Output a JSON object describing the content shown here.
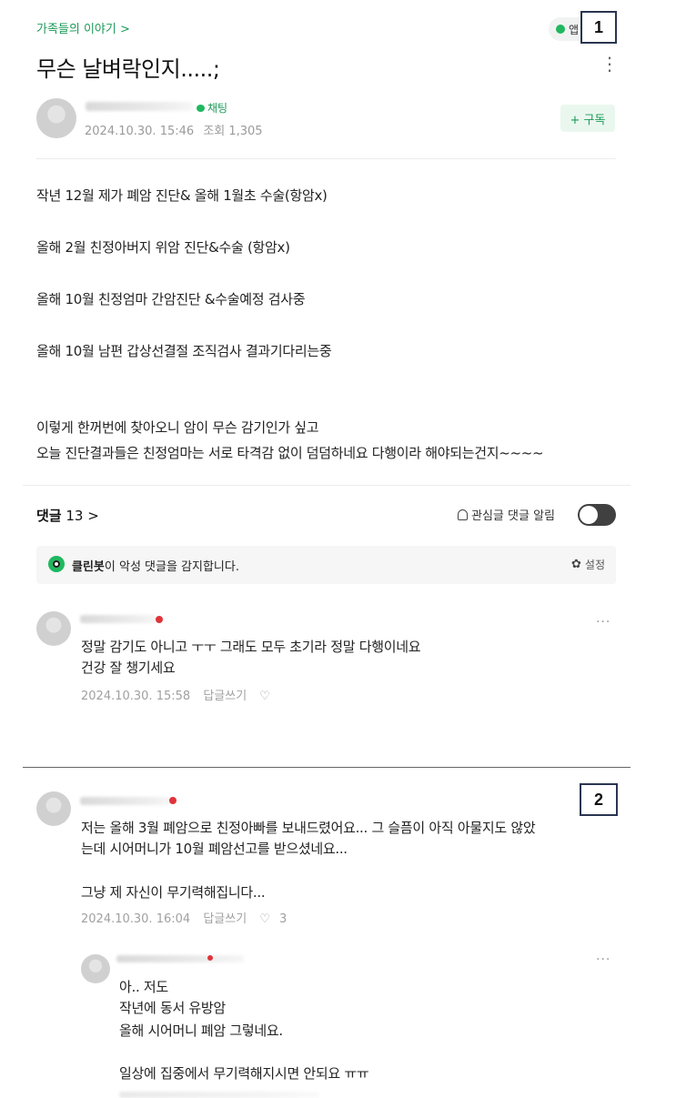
{
  "header": {
    "cafe_link": "가족들의 이야기 >",
    "app_badge": "앱",
    "marker_1": "1",
    "title": "무슨 날벼락인지.....;",
    "kebab": "⋮"
  },
  "author": {
    "chat_label": "채팅",
    "date": "2024.10.30. 15:46",
    "views": "조회 1,305",
    "subscribe": "+ 구독"
  },
  "post": {
    "lines": [
      "작년 12월 제가 폐암 진단& 올해 1월초 수술(항암x)",
      "올해 2월 친정아버지 위암 진단&수술 (항암x)",
      "올해 10월 친정엄마 간암진단 &수술예정 검사중",
      "올해 10월 남편 갑상선결절 조직검사 결과기다리는중",
      "이렇게 한꺼번에 찾아오니 암이 무슨 감기인가 싶고",
      "오늘 진단결과들은 친정엄마는 서로 타격감 없이 덤덤하네요 다행이라 해야되는건지~~~~"
    ]
  },
  "comments_bar": {
    "label": "댓글",
    "count": "13 >",
    "alarm": "관심글 댓글 알림"
  },
  "cleanbot": {
    "name": "클린봇",
    "text": "이 악성 댓글을 감지합니다.",
    "settings": "설정"
  },
  "comments": [
    {
      "lines": [
        "정말 감기도 아니고 ㅜㅜ 그래도 모두 초기라 정말 다행이네요",
        "건강 잘 챙기세요"
      ],
      "date": "2024.10.30. 15:58",
      "reply": "답글쓰기",
      "likes": ""
    },
    {
      "lines": [
        "저는 올해 3월 폐암으로 친정아빠를 보내드렸어요... 그 슬픔이 아직 아물지도 않았",
        "는데 시어머니가 10월 폐암선고를 받으셨네요...",
        "",
        "그냥 제 자신이 무기력해집니다..."
      ],
      "date": "2024.10.30. 16:04",
      "reply": "답글쓰기",
      "likes": "3",
      "marker_2": "2"
    },
    {
      "lines": [
        "아.. 저도",
        "작년에 동서 유방암",
        "올해 시어머니 폐암 그렇네요.",
        "",
        "일상에 집중에서 무기력해지시면 안되요 ㅠㅠ"
      ]
    }
  ],
  "icons": {
    "heart": "♡",
    "more": "···",
    "cog": "✿"
  }
}
